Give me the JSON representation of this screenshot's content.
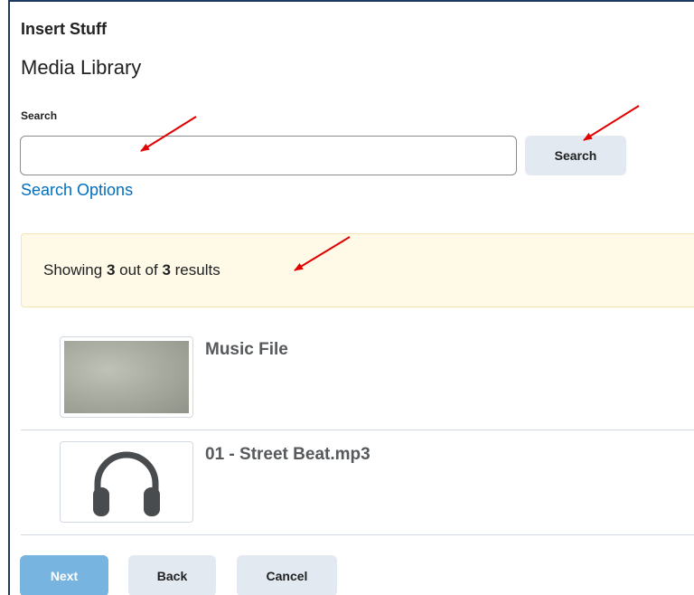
{
  "dialog": {
    "title": "Insert Stuff"
  },
  "panel": {
    "title": "Media Library"
  },
  "search": {
    "label": "Search",
    "value": "",
    "placeholder": "",
    "button_label": "Search",
    "options_link": "Search Options"
  },
  "results_summary": {
    "prefix": "Showing",
    "shown": "3",
    "middle": "out of",
    "total": "3",
    "suffix": "results"
  },
  "results": [
    {
      "title": "Music File",
      "thumbnail": "image-thumbnail"
    },
    {
      "title": "01 - Street Beat.mp3",
      "thumbnail": "headphones-icon"
    }
  ],
  "footer": {
    "next_label": "Next",
    "back_label": "Back",
    "cancel_label": "Cancel"
  },
  "colors": {
    "link": "#006fbf",
    "primary_button": "#78b4e0",
    "secondary_button": "#e3e9f1",
    "alert_background": "#fff9e8",
    "annotation_arrow": "#e00000"
  }
}
